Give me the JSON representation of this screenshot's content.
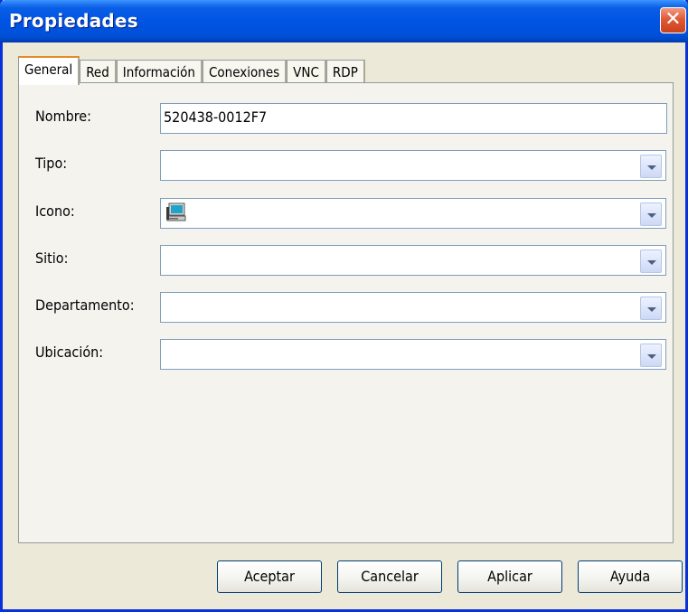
{
  "window": {
    "title": "Propiedades"
  },
  "tabs": [
    {
      "label": "General",
      "active": true
    },
    {
      "label": "Red",
      "active": false
    },
    {
      "label": "Información",
      "active": false
    },
    {
      "label": "Conexiones",
      "active": false
    },
    {
      "label": "VNC",
      "active": false
    },
    {
      "label": "RDP",
      "active": false
    }
  ],
  "form": {
    "nombre": {
      "label": "Nombre:",
      "value": "520438-0012F7"
    },
    "tipo": {
      "label": "Tipo:",
      "value": ""
    },
    "icono": {
      "label": "Icono:",
      "icon": "computer-icon"
    },
    "sitio": {
      "label": "Sitio:",
      "value": ""
    },
    "departamento": {
      "label": "Departamento:",
      "value": ""
    },
    "ubicacion": {
      "label": "Ubicación:",
      "value": ""
    }
  },
  "buttons": {
    "aceptar": "Aceptar",
    "cancelar": "Cancelar",
    "aplicar": "Aplicar",
    "ayuda": "Ayuda"
  },
  "colors": {
    "titlebar": "#0054e3",
    "close": "#e05a36",
    "active_tab_accent": "#e68b2c",
    "dialog_bg": "#ece9d8"
  }
}
